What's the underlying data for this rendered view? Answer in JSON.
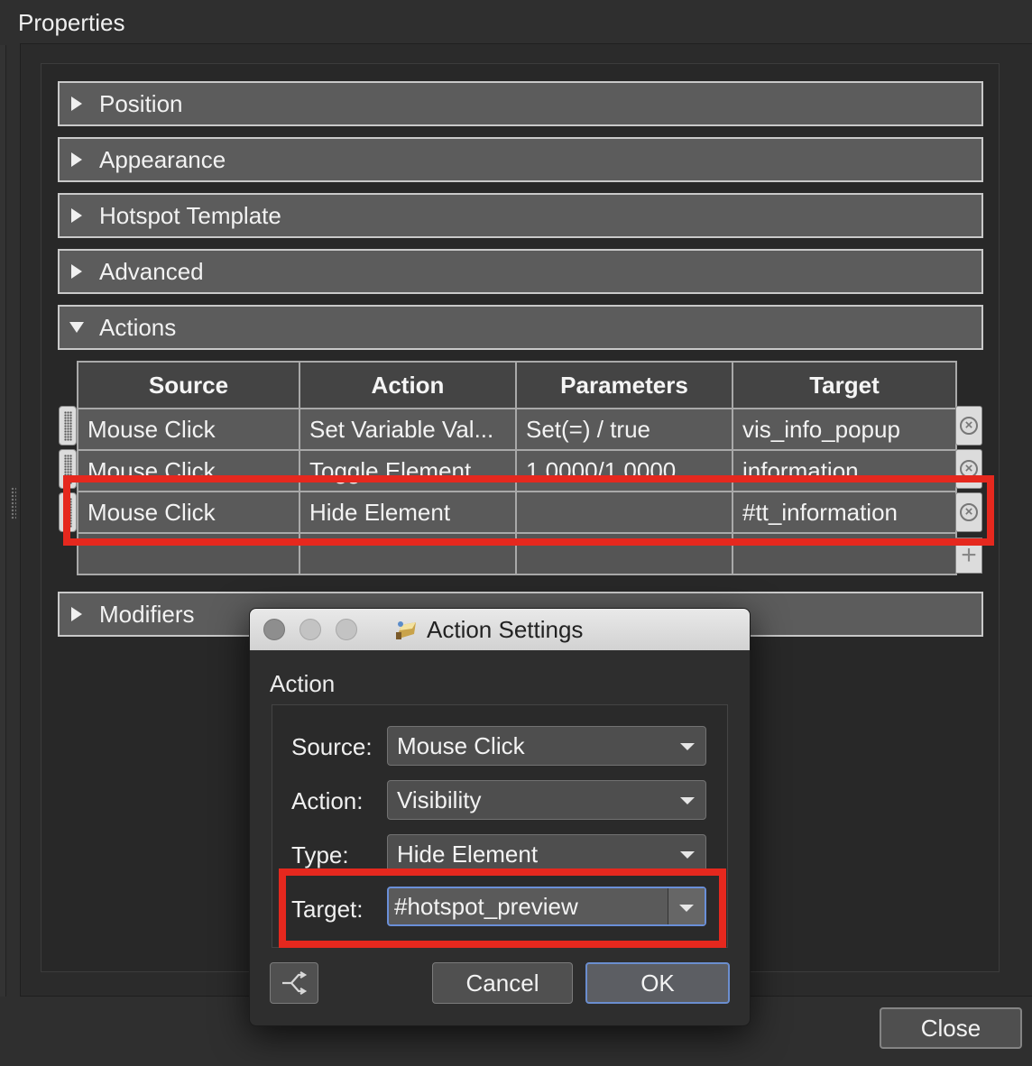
{
  "window": {
    "title": "Properties"
  },
  "sections": [
    {
      "label": "Position",
      "expanded": false
    },
    {
      "label": "Appearance",
      "expanded": false
    },
    {
      "label": "Hotspot Template",
      "expanded": false
    },
    {
      "label": "Advanced",
      "expanded": false
    },
    {
      "label": "Actions",
      "expanded": true
    },
    {
      "label": "Modifiers",
      "expanded": false
    }
  ],
  "actions_table": {
    "columns": [
      "Source",
      "Action",
      "Parameters",
      "Target"
    ],
    "rows": [
      {
        "source": "Mouse Click",
        "action": "Set Variable Val...",
        "parameters": "Set(=) / true",
        "target": "vis_info_popup"
      },
      {
        "source": "Mouse Click",
        "action": "Toggle Element ...",
        "parameters": "1.0000/1.0000",
        "target": "information"
      },
      {
        "source": "Mouse Click",
        "action": "Hide Element",
        "parameters": "",
        "target": "#tt_information"
      }
    ]
  },
  "dialog": {
    "title": "Action Settings",
    "group_label": "Action",
    "fields": {
      "source": {
        "label": "Source:",
        "value": "Mouse Click"
      },
      "action": {
        "label": "Action:",
        "value": "Visibility"
      },
      "type": {
        "label": "Type:",
        "value": "Hide Element"
      },
      "target": {
        "label": "Target:",
        "value": "#hotspot_preview"
      }
    },
    "cancel_label": "Cancel",
    "ok_label": "OK"
  },
  "footer": {
    "close_label": "Close"
  },
  "colors": {
    "highlight": "#e5281e",
    "focus": "#6a8fd8"
  }
}
